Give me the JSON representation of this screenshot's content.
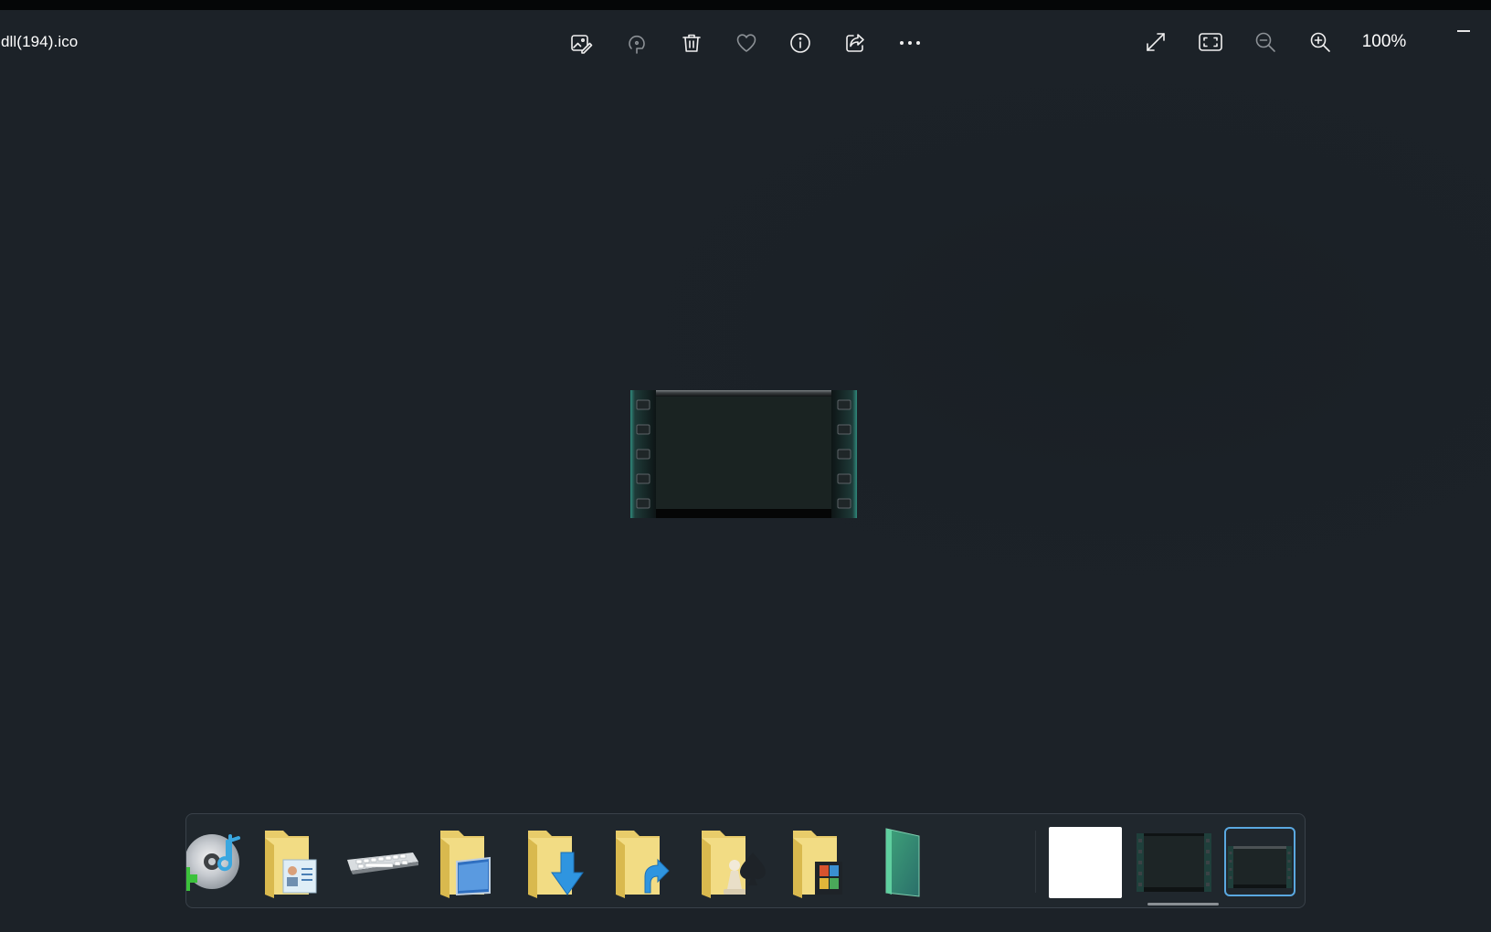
{
  "window": {
    "title": "dll(194).ico"
  },
  "toolbar": {
    "zoom_level": "100%"
  },
  "colors": {
    "background": "#1c2228",
    "filmstrip_bg": "#20272d",
    "selection_border": "#5aa8e0",
    "film_teal": "#2f8a7c"
  },
  "icons": {
    "edit": "edit-image-icon",
    "rotate": "rotate-icon",
    "delete": "trash-icon",
    "favorite": "heart-icon",
    "info": "info-icon",
    "share": "share-icon",
    "more": "more-icon",
    "full_screen": "expand-icon",
    "fit_window": "fit-to-window-icon",
    "zoom_out": "zoom-out-icon",
    "zoom_in": "zoom-in-icon",
    "minimize": "minimize-icon"
  },
  "filmstrip": {
    "items": [
      "media-disc-icon",
      "contacts-folder-icon",
      "keyboard-icon",
      "desktop-folder-icon",
      "downloads-folder-icon",
      "links-folder-icon",
      "games-folder-icon",
      "videos-folder-icon",
      "green-glass-panel-icon",
      "white-blank-image",
      "film-frame-image",
      "film-frame-image-selected"
    ]
  }
}
